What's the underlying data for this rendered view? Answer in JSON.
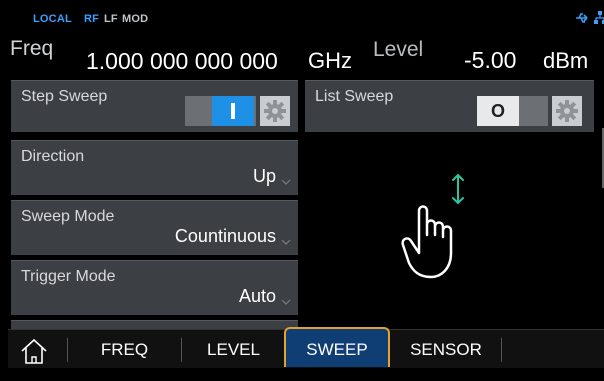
{
  "status_bar": {
    "local": "LOCAL",
    "rf": "RF",
    "lf": "LF",
    "mod": "MOD",
    "icons": [
      "usb-icon",
      "network-icon"
    ],
    "colors": {
      "active": "#3aa0ff",
      "inactive": "#bfc5cc"
    }
  },
  "header": {
    "freq_label": "Freq",
    "freq_value": "1.000 000 000 000",
    "freq_unit": "GHz",
    "level_label": "Level",
    "level_value": "-5.00",
    "level_unit": "dBm"
  },
  "panels": {
    "step_sweep": {
      "title": "Step Sweep",
      "toggle_state": "on",
      "toggle_symbol": "I"
    },
    "list_sweep": {
      "title": "List Sweep",
      "toggle_state": "off",
      "toggle_symbol": "O"
    },
    "direction": {
      "title": "Direction",
      "value": "Up"
    },
    "sweep_mode": {
      "title": "Sweep Mode",
      "value": "Countinuous"
    },
    "trigger_mode": {
      "title": "Trigger Mode",
      "value": "Auto"
    }
  },
  "gesture_hint": {
    "icon": "touch-swipe-vertical-icon",
    "arrow_color": "#2bc4a0"
  },
  "nav": {
    "home_icon": "home-icon",
    "items": [
      "FREQ",
      "LEVEL",
      "SWEEP",
      "SENSOR"
    ],
    "active": "SWEEP",
    "active_border_color": "#e3a32a",
    "active_bg_color": "#0f3e74"
  }
}
